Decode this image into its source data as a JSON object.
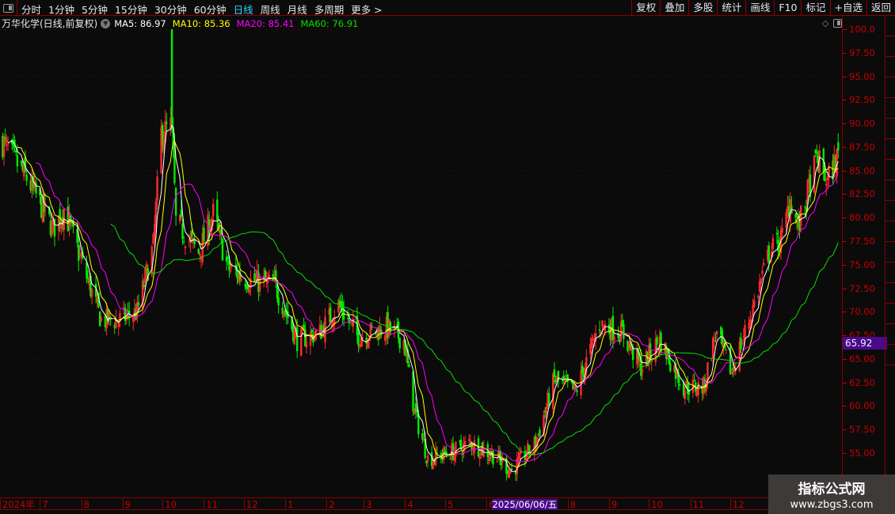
{
  "toolbar": {
    "periods": [
      "分时",
      "1分钟",
      "5分钟",
      "15分钟",
      "30分钟",
      "60分钟",
      "日线",
      "周线",
      "月线",
      "多周期",
      "更多 >"
    ],
    "active_period": "日线",
    "tools": [
      "复权",
      "叠加",
      "多股",
      "统计",
      "画线",
      "F10",
      "标记",
      "+自选",
      "返回"
    ]
  },
  "legend": {
    "title": "万华化学(日线,前复权)",
    "ma5": "MA5: 86.97",
    "ma10": "MA10: 85.36",
    "ma20": "MA20: 85.41",
    "ma60": "MA60: 76.91"
  },
  "colors": {
    "up": "#ff2a2a",
    "down": "#00ee00",
    "ma5": "#ffffff",
    "ma10": "#ffff00",
    "ma20": "#ff00ff",
    "ma60": "#00e000",
    "axis": "#c40000",
    "highlight": "#4a0a8c"
  },
  "price_tag": "65.92",
  "watermark": {
    "name": "指标公式网",
    "url": "www.zbgs3.com"
  },
  "chart_data": {
    "type": "candlestick",
    "ylim": [
      53,
      100
    ],
    "y_ticks": [
      "100.0",
      "97.50",
      "95.00",
      "92.50",
      "90.00",
      "87.50",
      "85.00",
      "82.50",
      "80.00",
      "77.50",
      "75.00",
      "72.50",
      "70.00",
      "67.50",
      "65.00",
      "62.50",
      "60.00",
      "57.50",
      "55.00"
    ],
    "x_labels": [
      {
        "label": "2024年",
        "date": "2024-06-01"
      },
      {
        "label": "7",
        "date": "2024-07-01"
      },
      {
        "label": "8",
        "date": "2024-08-01"
      },
      {
        "label": "9",
        "date": "2024-09-01"
      },
      {
        "label": "10",
        "date": "2024-10-01"
      },
      {
        "label": "11",
        "date": "2024-11-01"
      },
      {
        "label": "12",
        "date": "2024-12-01"
      },
      {
        "label": "1",
        "date": "2025-01-01"
      },
      {
        "label": "2",
        "date": "2025-02-01"
      },
      {
        "label": "3",
        "date": "2025-03-01"
      },
      {
        "label": "4",
        "date": "2025-04-01"
      },
      {
        "label": "5",
        "date": "2025-05-01"
      },
      {
        "label": "6",
        "date": "2025-06-01"
      },
      {
        "label": "8",
        "date": "2025-08-01"
      },
      {
        "label": "9",
        "date": "2025-09-01"
      },
      {
        "label": "10",
        "date": "2025-10-01"
      },
      {
        "label": "11",
        "date": "2025-11-01"
      },
      {
        "label": "12",
        "date": "2025-12-01"
      }
    ],
    "crosshair_date": {
      "label": "2025/06/06/五",
      "date": "2025-06-06"
    },
    "close_path": [
      [
        "2024-06-03",
        88.0
      ],
      [
        "2024-06-21",
        84.2
      ],
      [
        "2024-07-11",
        78.8
      ],
      [
        "2024-07-19",
        80.9
      ],
      [
        "2024-08-01",
        75.4
      ],
      [
        "2024-08-16",
        69.1
      ],
      [
        "2024-08-29",
        69.1
      ],
      [
        "2024-09-12",
        70.0
      ],
      [
        "2024-09-24",
        77.0
      ],
      [
        "2024-09-30",
        89.0
      ],
      [
        "2024-10-08",
        89.7
      ],
      [
        "2024-10-11",
        79.6
      ],
      [
        "2024-10-28",
        76.2
      ],
      [
        "2024-11-08",
        80.4
      ],
      [
        "2024-11-19",
        74.6
      ],
      [
        "2024-12-06",
        73.3
      ],
      [
        "2024-12-24",
        72.9
      ],
      [
        "2025-01-10",
        67.0
      ],
      [
        "2025-01-27",
        67.8
      ],
      [
        "2025-02-10",
        70.8
      ],
      [
        "2025-02-24",
        67.4
      ],
      [
        "2025-03-18",
        68.3
      ],
      [
        "2025-03-31",
        67.0
      ],
      [
        "2025-04-08",
        59.4
      ],
      [
        "2025-04-18",
        54.4
      ],
      [
        "2025-05-08",
        55.2
      ],
      [
        "2025-05-20",
        56.1
      ],
      [
        "2025-06-06",
        54.8
      ],
      [
        "2025-06-20",
        53.1
      ],
      [
        "2025-07-08",
        56.1
      ],
      [
        "2025-07-22",
        62.8
      ],
      [
        "2025-08-07",
        61.5
      ],
      [
        "2025-08-25",
        68.7
      ],
      [
        "2025-09-11",
        67.8
      ],
      [
        "2025-09-25",
        64.1
      ],
      [
        "2025-10-09",
        67.0
      ],
      [
        "2025-10-27",
        62.0
      ],
      [
        "2025-11-11",
        62.0
      ],
      [
        "2025-11-20",
        67.8
      ],
      [
        "2025-12-02",
        63.6
      ],
      [
        "2025-12-16",
        69.5
      ],
      [
        "2025-12-30",
        76.2
      ],
      [
        "2026-01-09",
        77.9
      ],
      [
        "2026-01-15",
        82.1
      ],
      [
        "2026-01-21",
        78.8
      ],
      [
        "2026-02-04",
        86.3
      ],
      [
        "2026-02-12",
        83.8
      ],
      [
        "2026-02-20",
        86.7
      ]
    ],
    "spike": {
      "date": "2024-10-08",
      "open": 100.0,
      "high": 100.0,
      "low": 89.0,
      "close": 89.7
    },
    "series": [
      {
        "name": "MA5",
        "period": 5
      },
      {
        "name": "MA10",
        "period": 10
      },
      {
        "name": "MA20",
        "period": 20
      },
      {
        "name": "MA60",
        "period": 60
      }
    ]
  }
}
